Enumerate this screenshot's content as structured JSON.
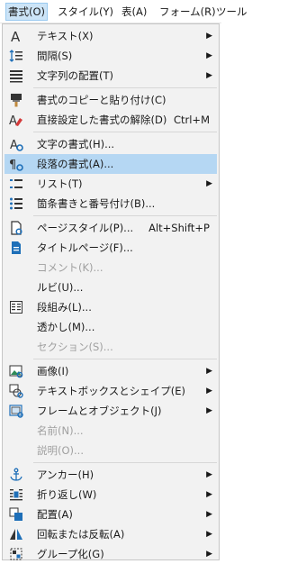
{
  "menubar": [
    {
      "label": "書式(O)",
      "active": true
    },
    {
      "label": "スタイル(Y)",
      "active": false
    },
    {
      "label": "表(A)",
      "active": false
    },
    {
      "label": "フォーム(R)",
      "active": false
    },
    {
      "label": "ツール",
      "active": false
    }
  ],
  "menu": {
    "items": [
      {
        "label": "テキスト(X)",
        "icon": "text-a-icon",
        "submenu": true
      },
      {
        "label": "間隔(S)",
        "icon": "line-spacing-icon",
        "submenu": true
      },
      {
        "label": "文字列の配置(T)",
        "icon": "align-icon",
        "submenu": true
      },
      {
        "label": "書式のコピーと貼り付け(C)",
        "icon": "paintbrush-icon"
      },
      {
        "label": "直接設定した書式の解除(D)",
        "icon": "eraser-icon",
        "shortcut": "Ctrl+M"
      },
      {
        "label": "文字の書式(H)...",
        "icon": "character-format-icon"
      },
      {
        "label": "段落の書式(A)...",
        "icon": "paragraph-format-icon",
        "highlighted": true
      },
      {
        "label": "リスト(T)",
        "icon": "list-icon",
        "submenu": true
      },
      {
        "label": "箇条書きと番号付け(B)...",
        "icon": "bullets-icon"
      },
      {
        "label": "ページスタイル(P)...",
        "icon": "page-style-icon",
        "shortcut": "Alt+Shift+P"
      },
      {
        "label": "タイトルページ(F)...",
        "icon": "title-page-icon"
      },
      {
        "label": "コメント(K)...",
        "disabled": true
      },
      {
        "label": "ルビ(U)..."
      },
      {
        "label": "段組み(L)...",
        "icon": "columns-icon"
      },
      {
        "label": "透かし(M)..."
      },
      {
        "label": "セクション(S)...",
        "disabled": true
      },
      {
        "label": "画像(I)",
        "icon": "image-icon",
        "submenu": true
      },
      {
        "label": "テキストボックスとシェイプ(E)",
        "icon": "textbox-shape-icon",
        "submenu": true
      },
      {
        "label": "フレームとオブジェクト(J)",
        "icon": "frame-object-icon",
        "submenu": true
      },
      {
        "label": "名前(N)...",
        "disabled": true
      },
      {
        "label": "説明(O)...",
        "disabled": true
      },
      {
        "label": "アンカー(H)",
        "icon": "anchor-icon",
        "submenu": true
      },
      {
        "label": "折り返し(W)",
        "icon": "wrap-icon",
        "submenu": true
      },
      {
        "label": "配置(A)",
        "icon": "arrange-icon",
        "submenu": true
      },
      {
        "label": "回転または反転(A)",
        "icon": "rotate-flip-icon",
        "submenu": true
      },
      {
        "label": "グループ化(G)",
        "icon": "group-icon",
        "submenu": true
      }
    ]
  },
  "colors": {
    "highlight": "#b5d7f3",
    "menubar_active": "#cce4f7",
    "icon_blue": "#1e6fb8",
    "icon_dark": "#333333",
    "disabled_text": "#a0a0a0"
  }
}
